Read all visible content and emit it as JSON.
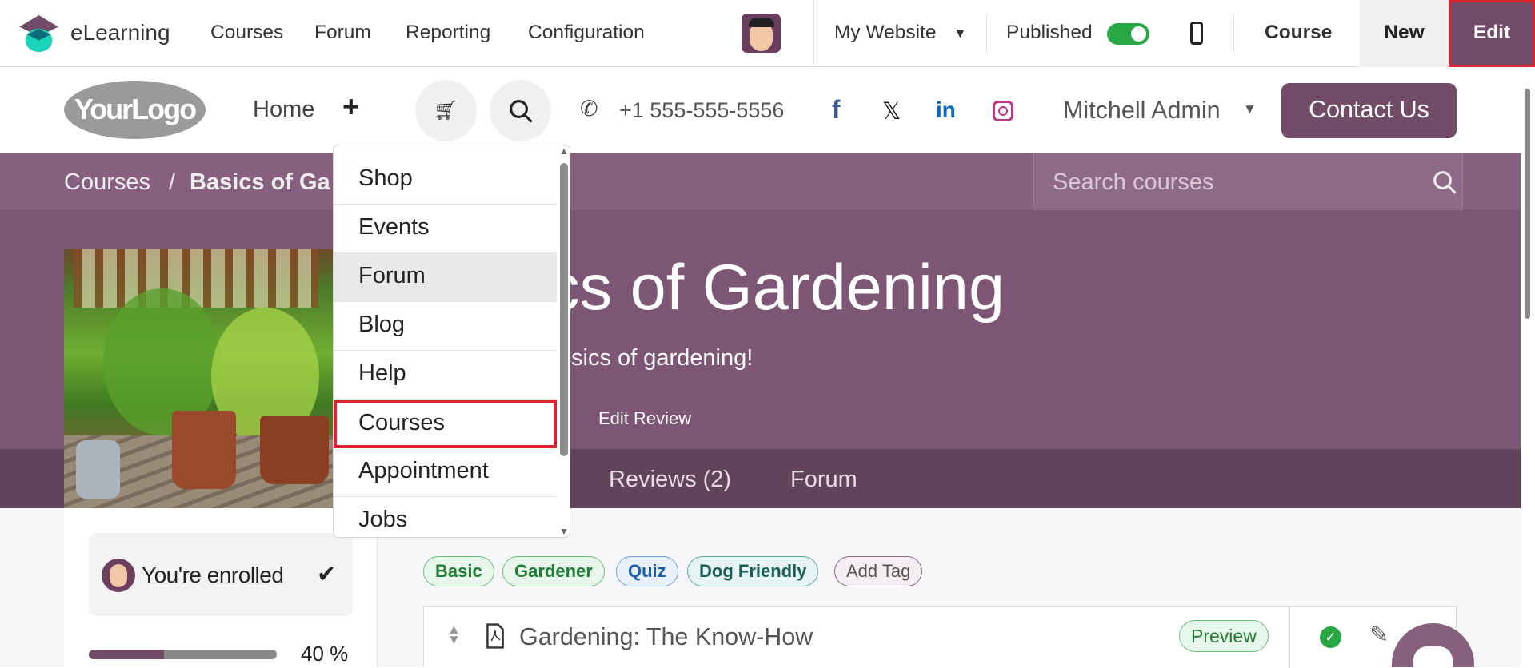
{
  "topbar": {
    "app": "eLearning",
    "menu": [
      "Courses",
      "Forum",
      "Reporting",
      "Configuration"
    ],
    "website": "My Website",
    "published": "Published",
    "published_on": true,
    "course": "Course",
    "new": "New",
    "edit": "Edit"
  },
  "header": {
    "logo": "YourLogo",
    "home": "Home",
    "phone": "+1 555-555-5556",
    "user": "Mitchell Admin",
    "contact": "Contact Us"
  },
  "hero": {
    "breadcrumb_root": "Courses",
    "breadcrumb_sep": "/",
    "breadcrumb_current": "Basics of Ga",
    "search_placeholder": "Search courses",
    "title": "Basics of Gardening",
    "subtitle_fragment": "sics of gardening!",
    "edit_review": "Edit Review",
    "tabs": [
      "Reviews (2)",
      "Forum"
    ]
  },
  "dropdown": {
    "items": [
      "Shop",
      "Events",
      "Forum",
      "Blog",
      "Help",
      "Courses",
      "Appointment",
      "Jobs"
    ]
  },
  "sidebar": {
    "enrolled": "You're enrolled",
    "progress_percent": 40,
    "progress_label": "40 %"
  },
  "tags": [
    "Basic",
    "Gardener",
    "Quiz",
    "Dog Friendly"
  ],
  "add_tag": "Add Tag",
  "lesson": {
    "title": "Gardening: The Know-How",
    "badge": "Preview"
  },
  "colors": {
    "brand": "#714b67",
    "published": "#28a745",
    "highlight": "#d9232e"
  }
}
